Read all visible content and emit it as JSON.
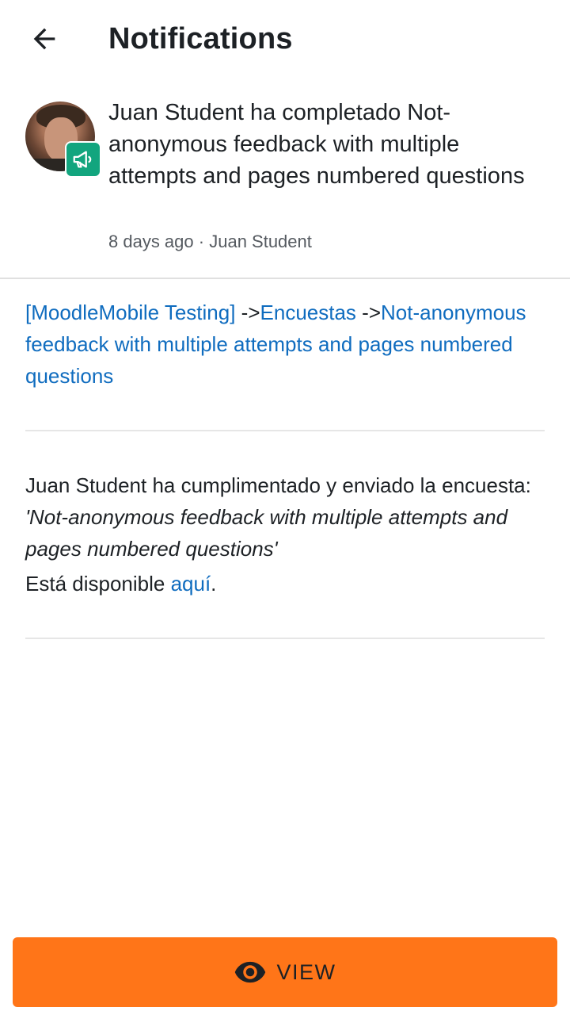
{
  "header": {
    "title": "Notifications",
    "back_icon": "arrow-left-icon"
  },
  "notification": {
    "text": "Juan Student ha completado Not-anonymous feedback with multiple attempts and pages numbered questions",
    "time": "8 days ago",
    "separator": "·",
    "author": "Juan Student",
    "badge_icon": "megaphone-icon",
    "badge_color": "#12a57e"
  },
  "breadcrumb": {
    "course": "[MoodleMobile Testing]",
    "arrow1": " ->",
    "section": "Encuestas",
    "arrow2": " ->",
    "activity": "Not-anonymous feedback with multiple attempts and pages numbered questions"
  },
  "message": {
    "intro": "Juan Student ha cumplimentado y enviado la encuesta: ",
    "activity_title": "'Not-anonymous feedback with multiple attempts and pages numbered questions'",
    "available_prefix": "Está disponible ",
    "available_link": "aquí",
    "available_suffix": "."
  },
  "footer": {
    "view_label": "VIEW",
    "view_icon": "eye-icon",
    "button_color": "#ff7518"
  },
  "colors": {
    "link": "#0f6cbf",
    "text": "#1d2125",
    "muted": "#555a60"
  }
}
